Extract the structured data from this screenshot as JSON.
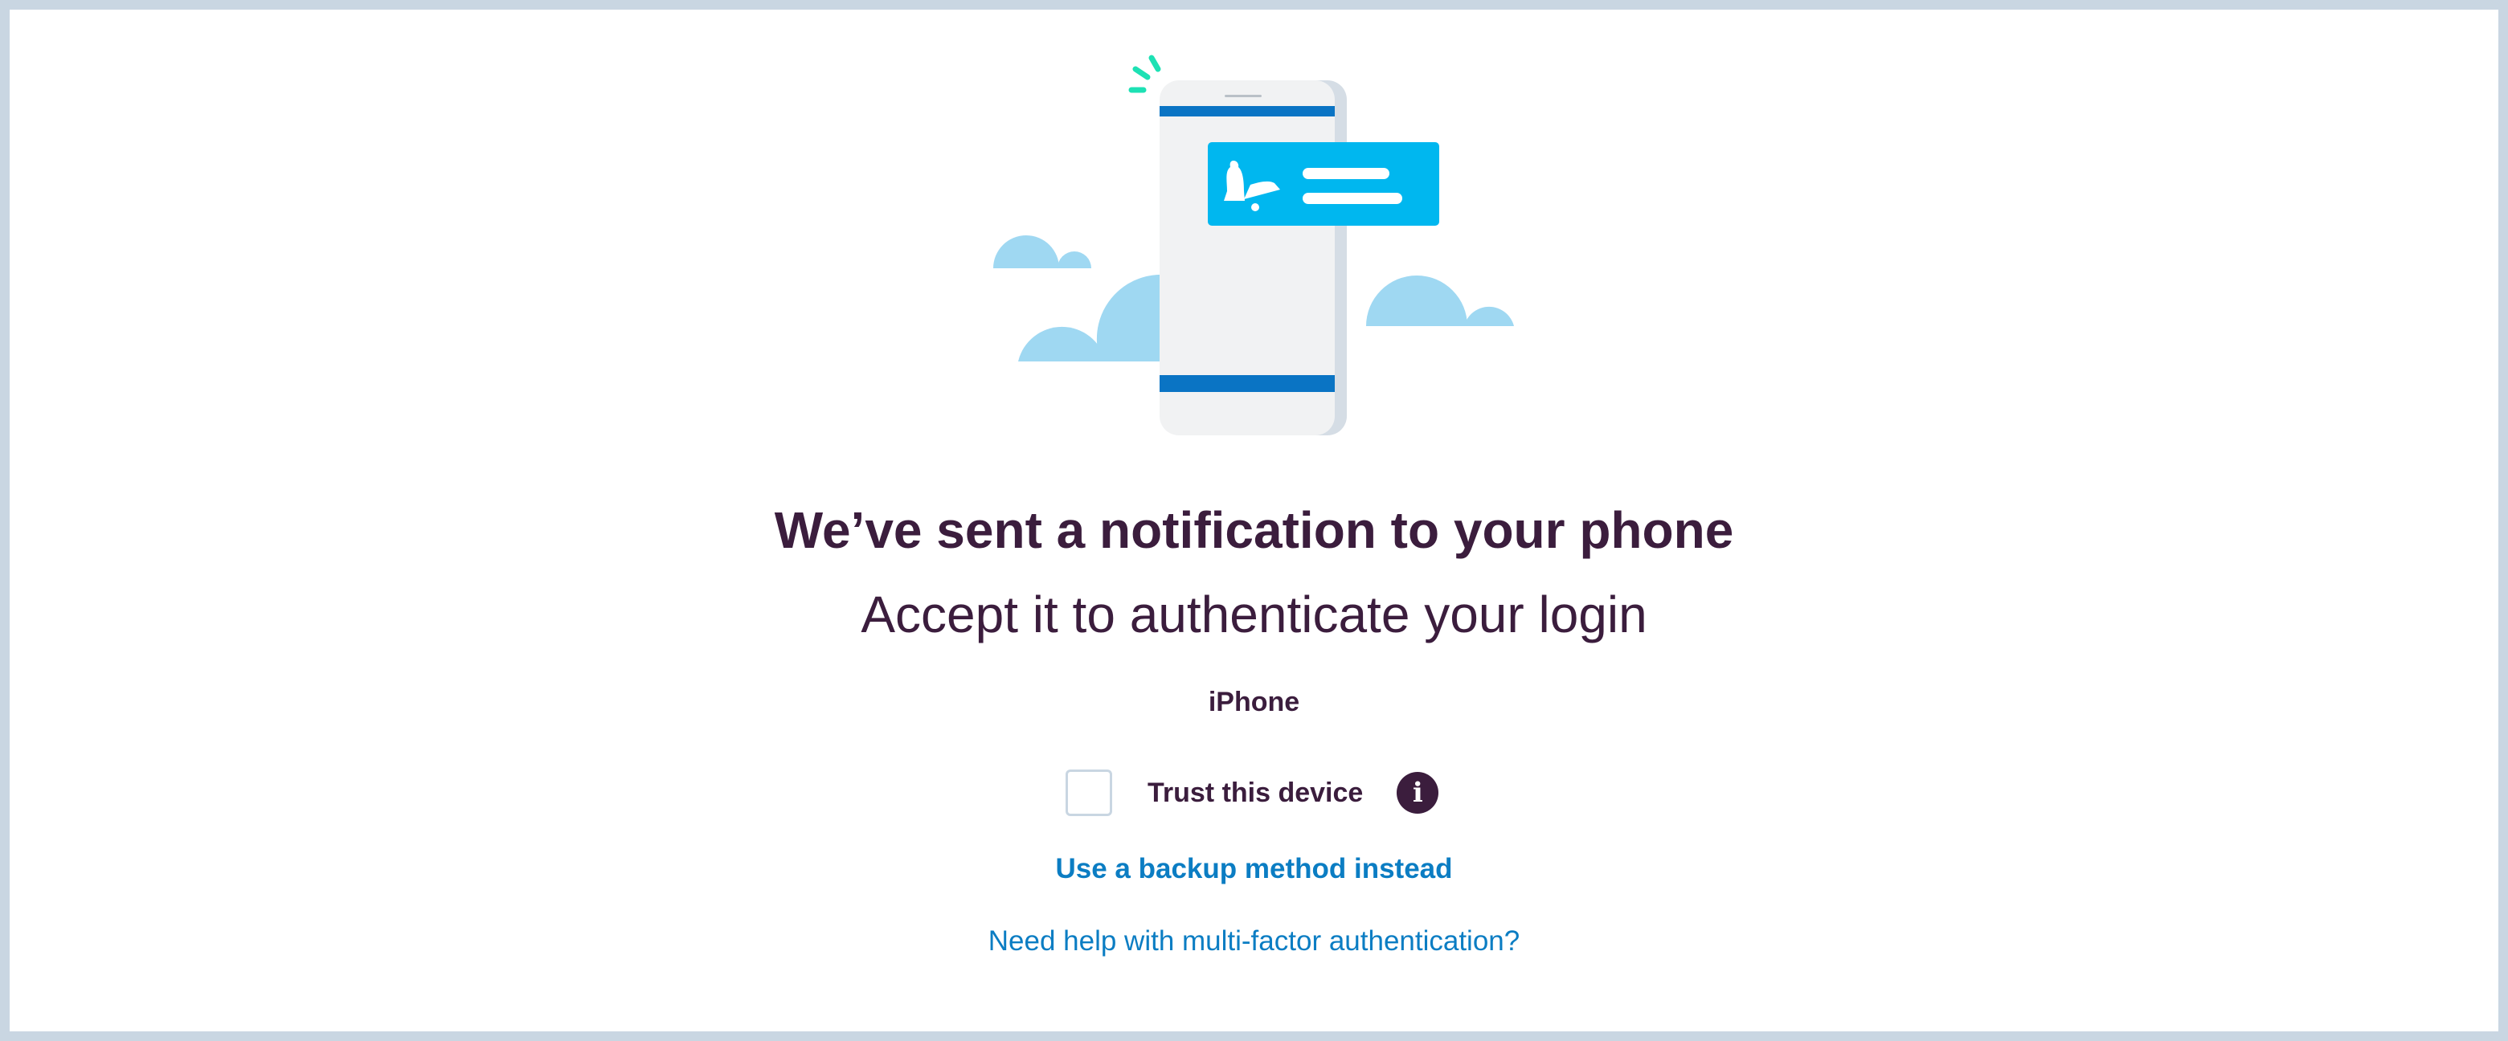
{
  "page": {
    "title": "We’ve sent a notification to your phone",
    "subtitle": "Accept it to authenticate your login",
    "device_name": "iPhone"
  },
  "trust": {
    "checked": false,
    "label": "Trust this device",
    "info_icon": "info-icon"
  },
  "links": {
    "backup": "Use a backup method instead",
    "help": "Need help with multi-factor authentication?"
  },
  "colors": {
    "text": "#3b1d3d",
    "link": "#0b7dc3",
    "border": "#c9d6e2",
    "notification": "#00b7ef",
    "phone_band": "#0a74c4",
    "cloud": "#9fd8f2",
    "sparkle": "#1de1b4"
  },
  "icons": {
    "illustration": "phone-notification-illustration",
    "bell": "bell-icon"
  }
}
